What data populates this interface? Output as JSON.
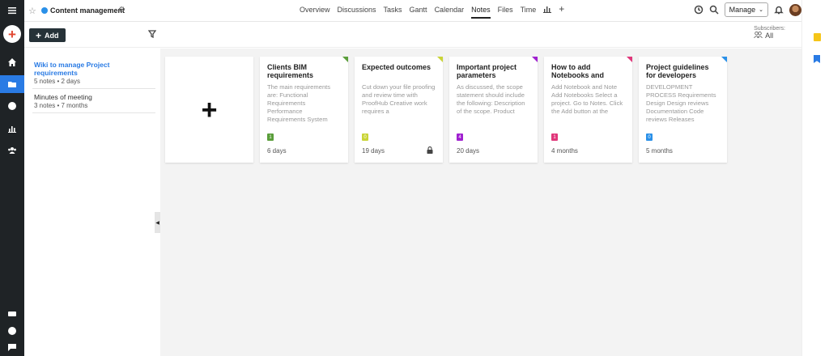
{
  "header": {
    "project_name": "Content management",
    "tabs": [
      {
        "label": "Overview",
        "active": false
      },
      {
        "label": "Discussions",
        "active": false
      },
      {
        "label": "Tasks",
        "active": false
      },
      {
        "label": "Gantt",
        "active": false
      },
      {
        "label": "Calendar",
        "active": false
      },
      {
        "label": "Notes",
        "active": true
      },
      {
        "label": "Files",
        "active": false
      },
      {
        "label": "Time",
        "active": false
      }
    ],
    "add_tab_label": "+",
    "manage_label": "Manage"
  },
  "toolbar": {
    "add_label": "Add",
    "subscribers_label": "Subscribers:",
    "subscribers_value": "All"
  },
  "notebooks": [
    {
      "title": "Wiki to manage Project requirements",
      "meta": "5 notes • 2 days",
      "active": true
    },
    {
      "title": "Minutes of meeting",
      "meta": "3 notes • 7 months",
      "active": false
    }
  ],
  "notes": [
    {
      "title": "Clients BIM requirements",
      "body": "The main requirements are: Functional Requirements Performance Requirements System Technical&nbs",
      "count": "1",
      "time": "6 days",
      "color": "#5a9e3a",
      "locked": false
    },
    {
      "title": "Expected outcomes",
      "body": "Cut down your file proofing and review time with ProofHub Creative work requires a",
      "count": "0",
      "time": "19 days",
      "color": "#c9d437",
      "locked": true
    },
    {
      "title": "Important project parameters",
      "body": "As discussed, the scope statement should include the following: Description of the scope. Product",
      "count": "4",
      "time": "20 days",
      "color": "#a020d0",
      "locked": false
    },
    {
      "title": "How to add Notebooks and notes",
      "body": "Add Notebook and Note Add Notebooks Select a project. Go to Notes. Click the Add button at the",
      "count": "1",
      "time": "4 months",
      "color": "#e0377a",
      "locked": false
    },
    {
      "title": "Project guidelines for developers",
      "body": "DEVELOPMENT PROCESS  Requirements Design Design reviews Documentation Code reviews Releases",
      "count": "0",
      "time": "5 months",
      "color": "#2a90e8",
      "locked": false
    }
  ]
}
